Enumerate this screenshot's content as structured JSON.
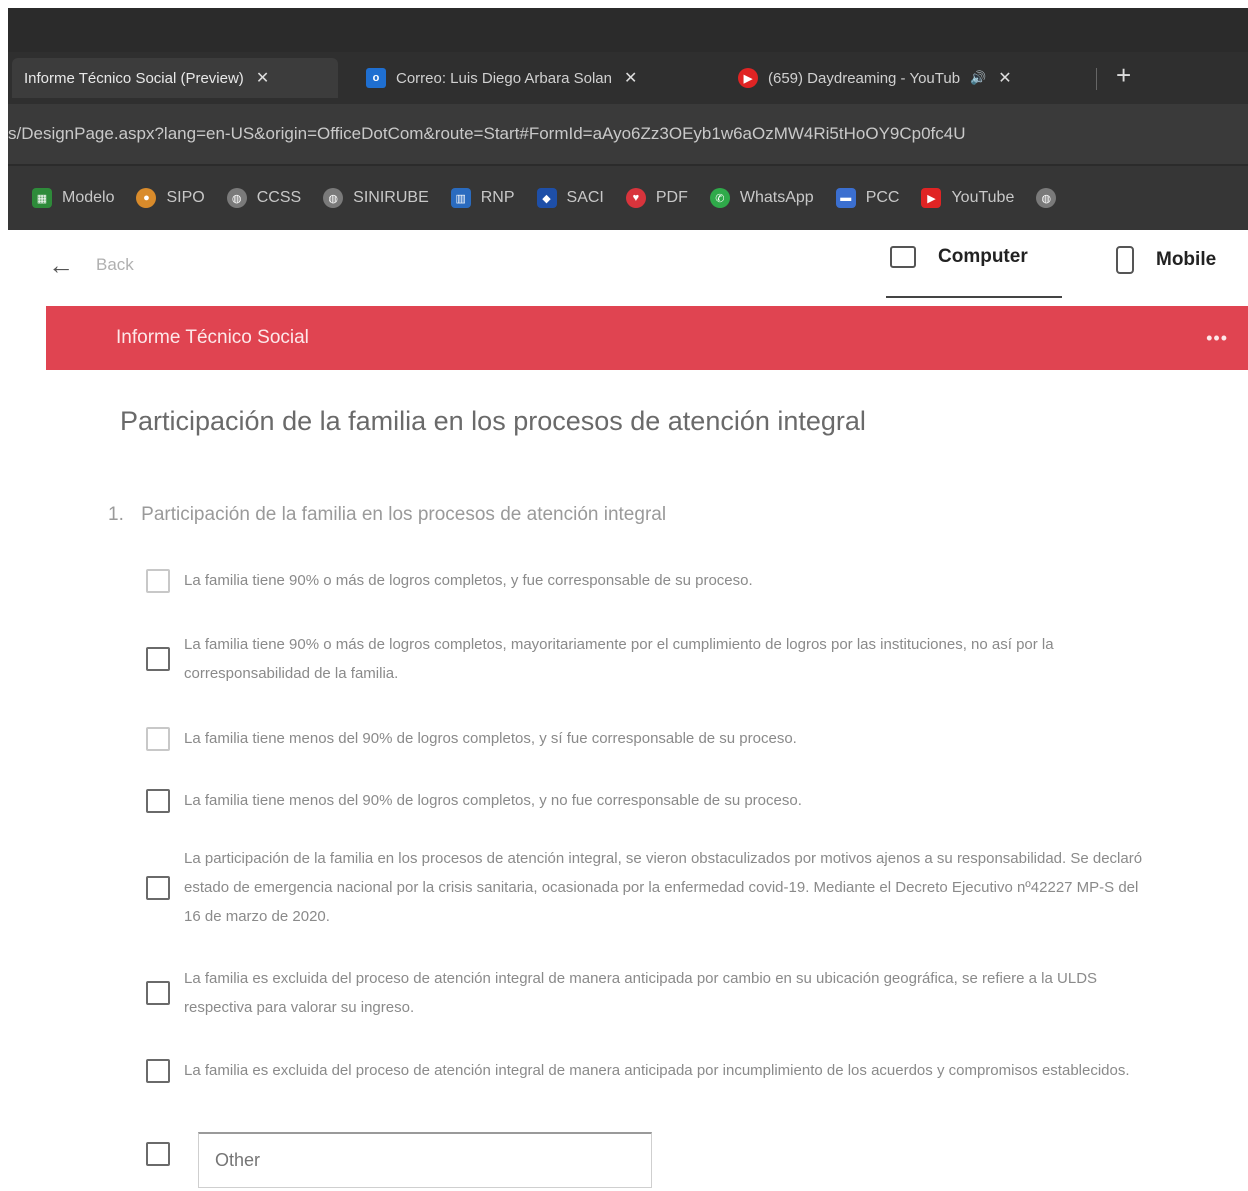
{
  "browser": {
    "tabs": [
      {
        "title": "Informe Técnico Social (Preview)",
        "active": true
      },
      {
        "title": "Correo: Luis Diego Arbara Solan",
        "active": false,
        "icon": "outlook-icon"
      },
      {
        "title": "(659) Daydreaming - YouTub",
        "active": false,
        "icon": "youtube-icon"
      }
    ],
    "url": "s/DesignPage.aspx?lang=en-US&origin=OfficeDotCom&route=Start#FormId=aAyo6Zz3OEyb1w6aOzMW4Ri5tHoOY9Cp0fc4U",
    "bookmarks": [
      {
        "label": "Modelo",
        "color": "#2e8b3a"
      },
      {
        "label": "SIPO",
        "color": "#d98b2b"
      },
      {
        "label": "CCSS",
        "color": "#7a7a7a"
      },
      {
        "label": "SINIRUBE",
        "color": "#7a7a7a"
      },
      {
        "label": "RNP",
        "color": "#2a6bbf"
      },
      {
        "label": "SACI",
        "color": "#1e4fa8"
      },
      {
        "label": "PDF",
        "color": "#d8343c"
      },
      {
        "label": "WhatsApp",
        "color": "#2faa4a"
      },
      {
        "label": "PCC",
        "color": "#3b6fd0"
      },
      {
        "label": "YouTube",
        "color": "#e02424"
      }
    ]
  },
  "header": {
    "back_label": "Back",
    "computer_label": "Computer",
    "mobile_label": "Mobile"
  },
  "form": {
    "title": "Informe Técnico Social",
    "more": "•••",
    "section_title": "Participación de la familia en los procesos de atención integral",
    "question_number": "1.",
    "question_text": "Participación de la familia en los procesos de atención integral",
    "options": [
      "La familia tiene 90% o más de logros completos, y fue corresponsable de su proceso.",
      "La familia tiene 90% o más de logros completos, mayoritariamente por el cumplimiento de logros por las instituciones, no así por la corresponsabilidad de la familia.",
      "La familia tiene menos del 90% de logros completos, y sí fue corresponsable de su proceso.",
      "La familia tiene menos del 90% de logros completos, y no fue corresponsable de su proceso.",
      "La participación de la familia en los procesos de atención integral, se vieron obstaculizados por motivos ajenos a su responsabilidad. Se declaró estado de emergencia nacional por la crisis sanitaria, ocasionada por la enfermedad covid-19. Mediante el Decreto Ejecutivo nº42227 MP-S del 16 de marzo de 2020.",
      "La familia es excluida del proceso de atención integral de manera anticipada por cambio en su ubicación geográfica, se refiere a la ULDS respectiva para valorar su ingreso.",
      "La familia es excluida del proceso de atención integral de manera anticipada por incumplimiento de los acuerdos y compromisos establecidos."
    ],
    "other_label": "Other"
  }
}
